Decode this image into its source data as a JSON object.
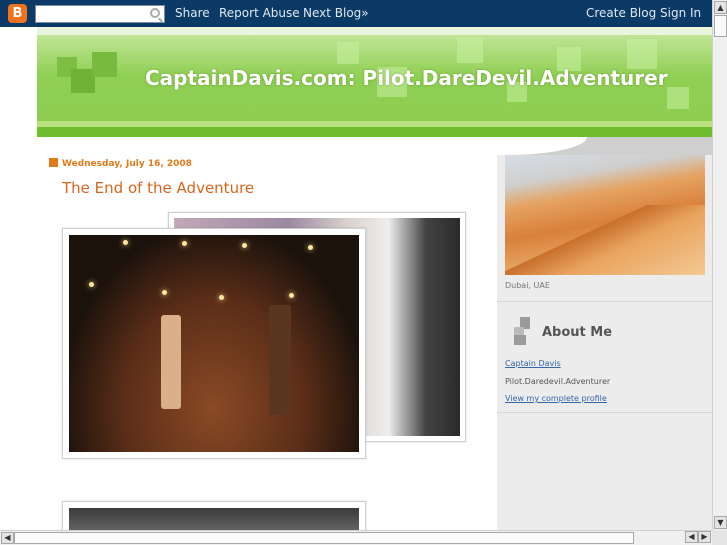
{
  "navbar": {
    "logo_letter": "B",
    "search_placeholder": "",
    "share": "Share",
    "report_abuse": "Report Abuse",
    "next_blog": "Next Blog»",
    "create_blog": "Create Blog",
    "sign_in": "Sign In"
  },
  "header": {
    "title": "CaptainDavis.com: Pilot.DareDevil.Adventurer"
  },
  "post": {
    "date": "Wednesday, July 16, 2008",
    "title": "The End of the Adventure"
  },
  "sidebar": {
    "photo_caption": "Dubai, UAE",
    "about_title": "About Me",
    "profile_name": "Captain Davis",
    "profile_text": "Pilot.Daredevil.Adventurer",
    "profile_link": "View my complete profile"
  },
  "colors": {
    "navbar_bg": "#0b3a67",
    "header_green": "#8fcf53",
    "accent_orange": "#e07a1b",
    "link_blue": "#3366aa"
  }
}
